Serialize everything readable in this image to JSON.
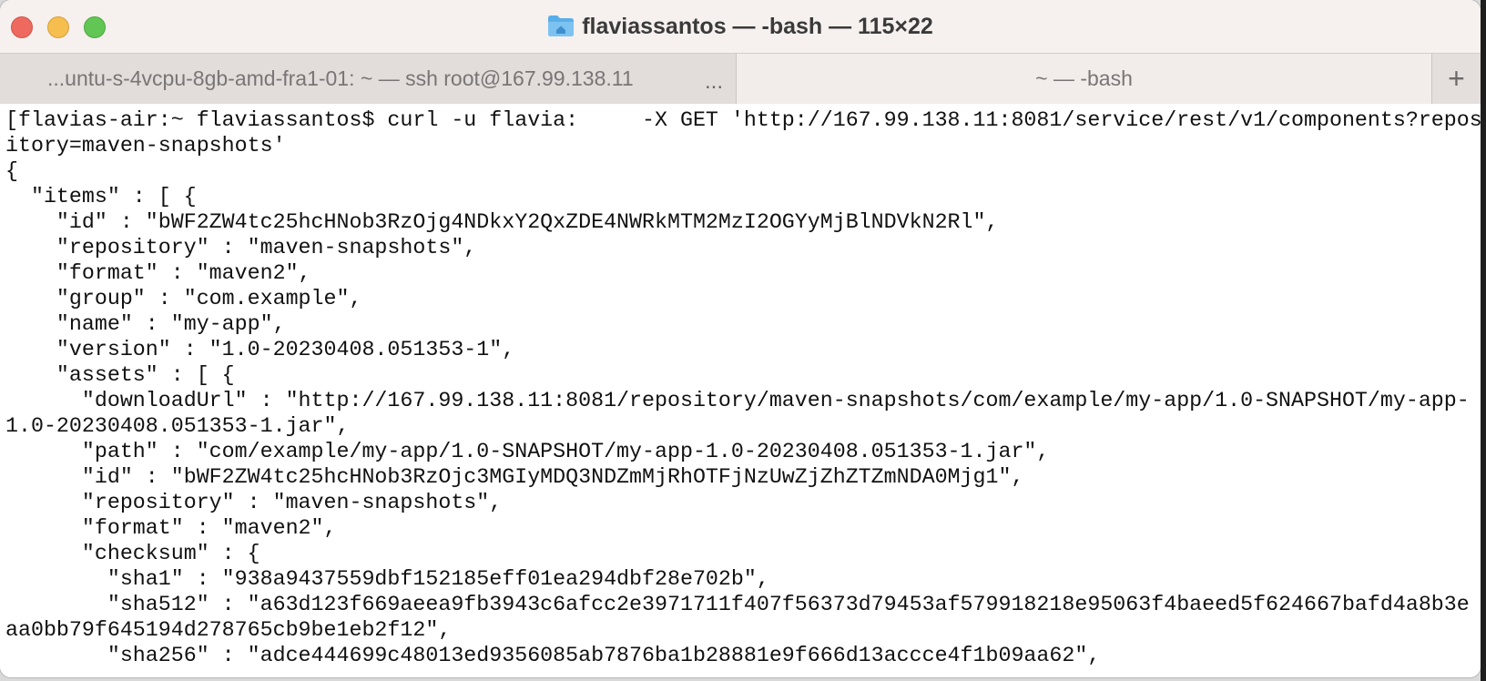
{
  "window": {
    "title": "flaviassantos — -bash — 115×22"
  },
  "tabs": [
    {
      "label": "...untu-s-4vcpu-8gb-amd-fra1-01: ~ — ssh root@167.99.138.11",
      "more": "..."
    },
    {
      "label": "~ — -bash"
    }
  ],
  "tab_add_label": "+",
  "terminal": {
    "lines": [
      "[flavias-air:~ flaviassantos$ curl -u flavia:     -X GET 'http://167.99.138.11:8081/service/rest/v1/components?repos]",
      "itory=maven-snapshots'",
      "{",
      "  \"items\" : [ {",
      "    \"id\" : \"bWF2ZW4tc25hcHNob3RzOjg4NDkxY2QxZDE4NWRkMTM2MzI2OGYyMjBlNDVkN2Rl\",",
      "    \"repository\" : \"maven-snapshots\",",
      "    \"format\" : \"maven2\",",
      "    \"group\" : \"com.example\",",
      "    \"name\" : \"my-app\",",
      "    \"version\" : \"1.0-20230408.051353-1\",",
      "    \"assets\" : [ {",
      "      \"downloadUrl\" : \"http://167.99.138.11:8081/repository/maven-snapshots/com/example/my-app/1.0-SNAPSHOT/my-app-",
      "1.0-20230408.051353-1.jar\",",
      "      \"path\" : \"com/example/my-app/1.0-SNAPSHOT/my-app-1.0-20230408.051353-1.jar\",",
      "      \"id\" : \"bWF2ZW4tc25hcHNob3RzOjc3MGIyMDQ3NDZmMjRhOTFjNzUwZjZhZTZmNDA0Mjg1\",",
      "      \"repository\" : \"maven-snapshots\",",
      "      \"format\" : \"maven2\",",
      "      \"checksum\" : {",
      "        \"sha1\" : \"938a9437559dbf152185eff01ea294dbf28e702b\",",
      "        \"sha512\" : \"a63d123f669aeea9fb3943c6afcc2e3971711f407f56373d79453af579918218e95063f4baeed5f624667bafd4a8b3e",
      "aa0bb79f645194d278765cb9be1eb2f12\",",
      "        \"sha256\" : \"adce444699c48013ed9356085ab7876ba1b28881e9f666d13accce4f1b09aa62\","
    ]
  }
}
